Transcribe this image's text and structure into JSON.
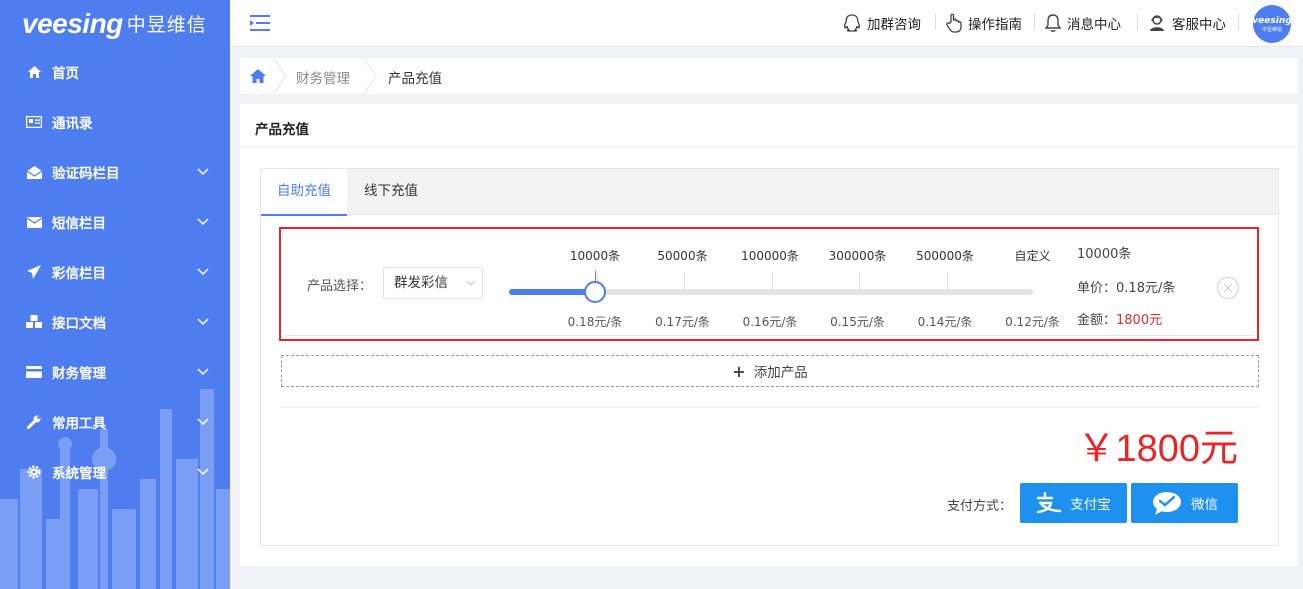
{
  "logo": {
    "brand": "veesing",
    "brand_cn": "中昱维信"
  },
  "sidebar": {
    "items": [
      {
        "label": "首页",
        "icon": "home-icon"
      },
      {
        "label": "通讯录",
        "icon": "address-card-icon"
      },
      {
        "label": "验证码栏目",
        "icon": "envelope-open-icon"
      },
      {
        "label": "短信栏目",
        "icon": "envelope-icon"
      },
      {
        "label": "彩信栏目",
        "icon": "paper-plane-icon"
      },
      {
        "label": "接口文档",
        "icon": "cubes-icon"
      },
      {
        "label": "财务管理",
        "icon": "credit-card-icon"
      },
      {
        "label": "常用工具",
        "icon": "wrench-icon"
      },
      {
        "label": "系统管理",
        "icon": "gear-icon"
      }
    ]
  },
  "header": {
    "links": [
      {
        "label": "加群咨询",
        "icon": "qq-icon"
      },
      {
        "label": "操作指南",
        "icon": "hand-pointer-icon"
      },
      {
        "label": "消息中心",
        "icon": "bell-icon"
      },
      {
        "label": "客服中心",
        "icon": "user-service-icon"
      }
    ],
    "avatar_text": "veesing",
    "avatar_sub": "中昱维信"
  },
  "breadcrumb": {
    "items": [
      "财务管理",
      "产品充值"
    ]
  },
  "card": {
    "title": "产品充值"
  },
  "tabs": [
    {
      "label": "自助充值",
      "active": true
    },
    {
      "label": "线下充值",
      "active": false
    }
  ],
  "product": {
    "select_label": "产品选择：",
    "selected_product": "群发彩信",
    "tiers": [
      {
        "qty": "10000条",
        "price": "0.18元/条"
      },
      {
        "qty": "50000条",
        "price": "0.17元/条"
      },
      {
        "qty": "100000条",
        "price": "0.16元/条"
      },
      {
        "qty": "300000条",
        "price": "0.15元/条"
      },
      {
        "qty": "500000条",
        "price": "0.14元/条"
      },
      {
        "qty": "自定义",
        "price": "0.12元/条"
      }
    ],
    "slider_selected_tier": 0,
    "summary_qty": "10000条",
    "unit_price_label": "单价：",
    "unit_price": "0.18元/条",
    "amount_label": "金额：",
    "amount": "1800元"
  },
  "add_product_label": "添加产品",
  "total": "￥1800元",
  "payment": {
    "label": "支付方式：",
    "methods": [
      {
        "label": "支付宝",
        "icon": "alipay-icon",
        "color": "#1e90ee"
      },
      {
        "label": "微信",
        "icon": "wechat-icon",
        "color": "#1e90ee"
      }
    ]
  },
  "colors": {
    "primary": "#4e7df0",
    "danger": "#e8262a",
    "pay": "#1e90ee"
  }
}
